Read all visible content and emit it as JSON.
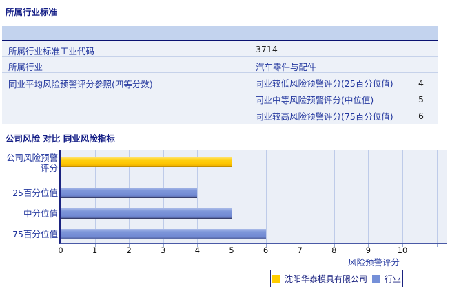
{
  "section1": {
    "title": "所属行业标准",
    "table": {
      "rows": [
        {
          "label": "所属行业标准工业代码",
          "value": "3714"
        },
        {
          "label": "所属行业",
          "value": "汽车零件与配件"
        },
        {
          "label": "同业平均风险预警评分参照(四等分数)",
          "sub_rows": [
            {
              "label": "同业较低风险预警评分(25百分位值)",
              "value": "4"
            },
            {
              "label": "同业中等风险预警评分(中位值)",
              "value": "5"
            },
            {
              "label": "同业较高风险预警评分(75百分位值)",
              "value": "6"
            }
          ]
        }
      ]
    }
  },
  "section2": {
    "title": "公司风险 对比 同业风险指标"
  },
  "chart_data": {
    "type": "bar",
    "orientation": "horizontal",
    "title": "",
    "xlabel": "风险预警评分",
    "ylabel": "",
    "xlim": [
      0,
      11.3
    ],
    "xticks": [
      0,
      1,
      2,
      3,
      4,
      5,
      6,
      7,
      8,
      9,
      10
    ],
    "grid": true,
    "legend_position": "bottom",
    "categories": [
      "公司风险预警评分",
      "25百分位值",
      "中分位值",
      "75百分位值"
    ],
    "category_label_lines": [
      [
        "公司风险预警",
        "评分"
      ],
      [
        "25百分位值"
      ],
      [
        "中分位值"
      ],
      [
        "75百分位值"
      ]
    ],
    "series": [
      {
        "name": "沈阳华泰模具有限公司",
        "color": "#ffcc00",
        "values": [
          5,
          null,
          null,
          null
        ]
      },
      {
        "name": "行业",
        "color": "#7590d8",
        "values": [
          null,
          4,
          5,
          6
        ]
      }
    ]
  },
  "colors": {
    "title_navy": "#141e86",
    "label_navy": "#23379e",
    "value_text": "#222222",
    "table_header_bg": "#c3d3ee",
    "table_header_border": "#0a1272",
    "row_bg": "#edf1f8",
    "row_border": "#c6d2ea",
    "plot_bg": "#ebeff7",
    "gridline": "#becbe9",
    "y_axis": "#1b2380",
    "x_axis": "#4a5aa6",
    "bar_yellow": "#ffcc00",
    "bar_yellow_border": "#c38f00",
    "bar_blue": "#7590d8",
    "bar_blue_border": "#39406e"
  }
}
